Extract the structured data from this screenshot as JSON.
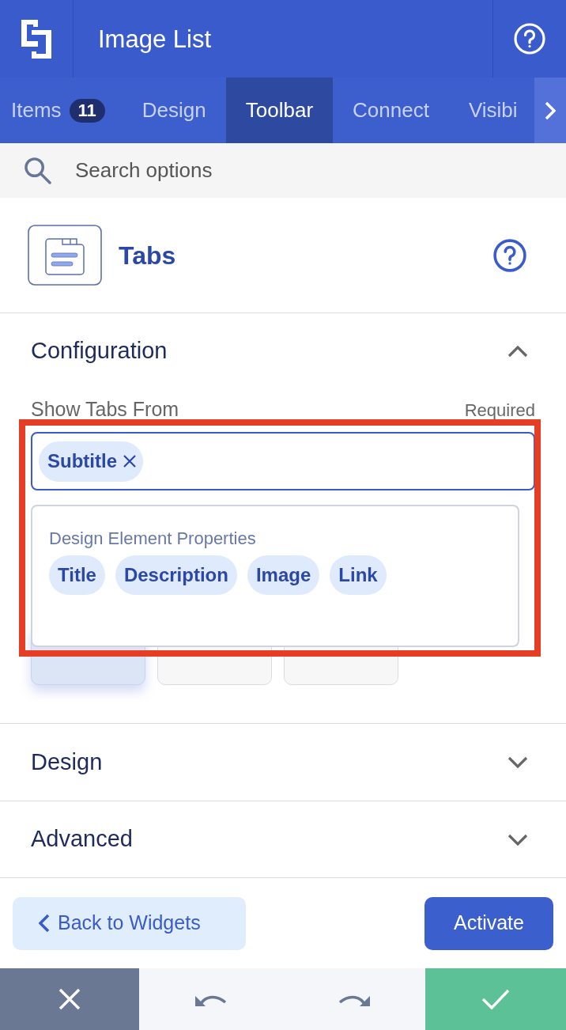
{
  "header": {
    "title": "Image List"
  },
  "tabs": [
    {
      "label": "Items",
      "badge": "11",
      "selected": false
    },
    {
      "label": "Design",
      "selected": false
    },
    {
      "label": "Toolbar",
      "selected": true
    },
    {
      "label": "Connect",
      "selected": false
    },
    {
      "label": "Visibi",
      "selected": false
    }
  ],
  "search": {
    "placeholder": "Search options"
  },
  "widget": {
    "title": "Tabs"
  },
  "sections": [
    {
      "title": "Configuration",
      "expanded": true,
      "content": {
        "field_label": "Show Tabs From",
        "required": "Required",
        "chips": [
          "Subtitle"
        ],
        "dropdown": {
          "group": "Design Element Properties",
          "options": [
            "Title",
            "Description",
            "Image",
            "Link"
          ]
        },
        "cards": [
          {
            "selected": true
          },
          {
            "selected": false
          },
          {
            "selected": false
          }
        ]
      }
    },
    {
      "title": "Design",
      "expanded": false
    },
    {
      "title": "Advanced",
      "expanded": false
    }
  ],
  "actions": {
    "back": "Back to Widgets",
    "primary": "Activate"
  },
  "toolbar": [
    {
      "kind": "cancel"
    },
    {
      "kind": "undo"
    },
    {
      "kind": "redo"
    },
    {
      "kind": "confirm"
    }
  ],
  "annotation": {
    "kind": "highlight-box"
  }
}
